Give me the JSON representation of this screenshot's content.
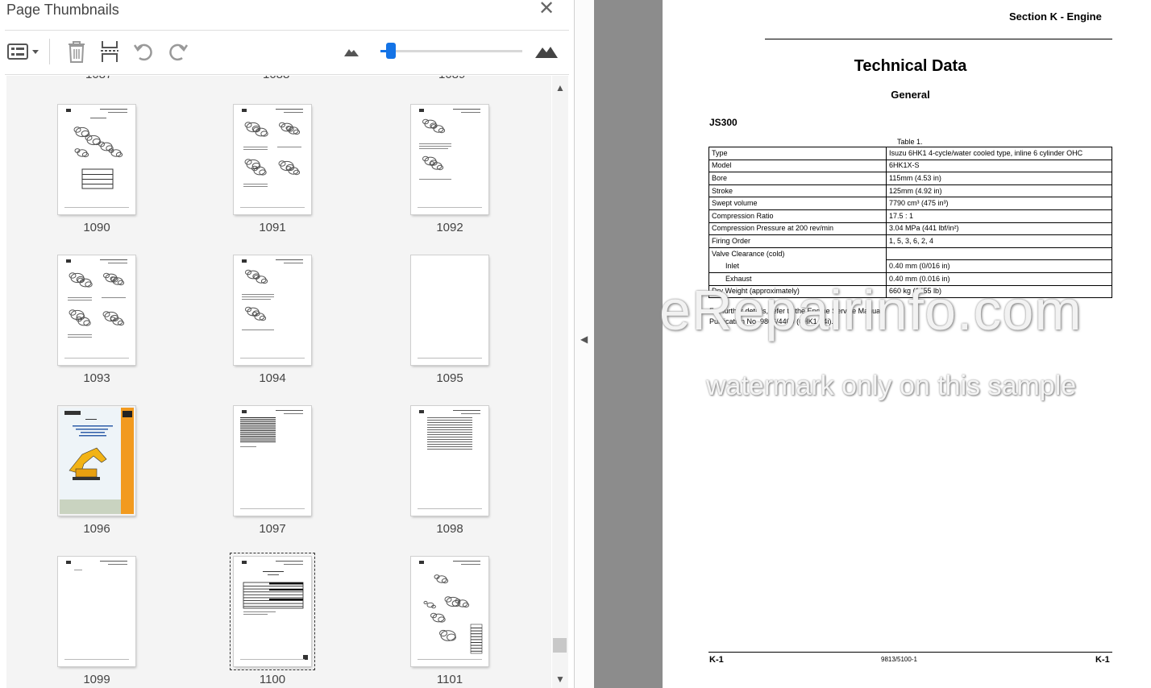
{
  "panel": {
    "title": "Page Thumbnails",
    "close_icon": "close-icon",
    "toolbar": {
      "options_icon": "thumbnail-options-icon",
      "delete_icon": "trash-icon",
      "extract_icon": "insert-pages-icon",
      "rotate_ccw_icon": "rotate-counterclockwise-icon",
      "rotate_cw_icon": "rotate-clockwise-icon",
      "zoom_out_icon": "small-mountain-icon",
      "zoom_in_icon": "large-mountain-icon",
      "zoom_level": 0.04
    },
    "thumbnails": [
      {
        "label": "1090",
        "kind": "diagram-table"
      },
      {
        "label": "1091",
        "kind": "diagram-multi"
      },
      {
        "label": "1092",
        "kind": "diagram-small"
      },
      {
        "label": "1093",
        "kind": "diagram-multi"
      },
      {
        "label": "1094",
        "kind": "diagram-small"
      },
      {
        "label": "1095",
        "kind": "blank"
      },
      {
        "label": "1096",
        "kind": "cover"
      },
      {
        "label": "1097",
        "kind": "lines"
      },
      {
        "label": "1098",
        "kind": "toc"
      },
      {
        "label": "1099",
        "kind": "header-only"
      },
      {
        "label": "1100",
        "kind": "table",
        "selected": true
      },
      {
        "label": "1101",
        "kind": "parts"
      }
    ]
  },
  "document": {
    "section_header": "Section K - Engine",
    "title": "Technical Data",
    "subtitle": "General",
    "model_heading": "JS300",
    "table_caption": "Table 1.",
    "table_rows": [
      {
        "label": "Type",
        "value": "Isuzu 6HK1 4-cycle/water cooled type, inline 6 cylinder OHC"
      },
      {
        "label": "Model",
        "value": "6HK1X-S"
      },
      {
        "label": "Bore",
        "value": "115mm (4.53 in)"
      },
      {
        "label": "Stroke",
        "value": "125mm (4.92 in)"
      },
      {
        "label": "Swept volume",
        "value": "7790 cm³ (475 in³)"
      },
      {
        "label": "Compression Ratio",
        "value": "17.5 : 1"
      },
      {
        "label": "Compression Pressure at 200 rev/min",
        "value": "3.04 MPa (441 lbf/in²)"
      },
      {
        "label": "Firing Order",
        "value": "1, 5, 3, 6, 2, 4"
      },
      {
        "label": "Valve Clearance (cold)",
        "value": ""
      },
      {
        "label": "Inlet",
        "value": "0.40 mm (0/016 in)"
      },
      {
        "label": "Exhaust",
        "value": "0.40 mm (0.016 in)"
      },
      {
        "label": "Dry Weight (approximately)",
        "value": "660 kg (1455 lb)"
      }
    ],
    "note_line1": "For further details, refer to the Engine Service Manual,",
    "note_line2": "Publication No. 9806/4400 (6HK1 T4i).",
    "footer_left": "K-1",
    "footer_mid": "9813/5100-1",
    "footer_right": "K-1",
    "watermark_main": "eRepairinfo.com",
    "watermark_sub": "watermark only on this sample"
  }
}
